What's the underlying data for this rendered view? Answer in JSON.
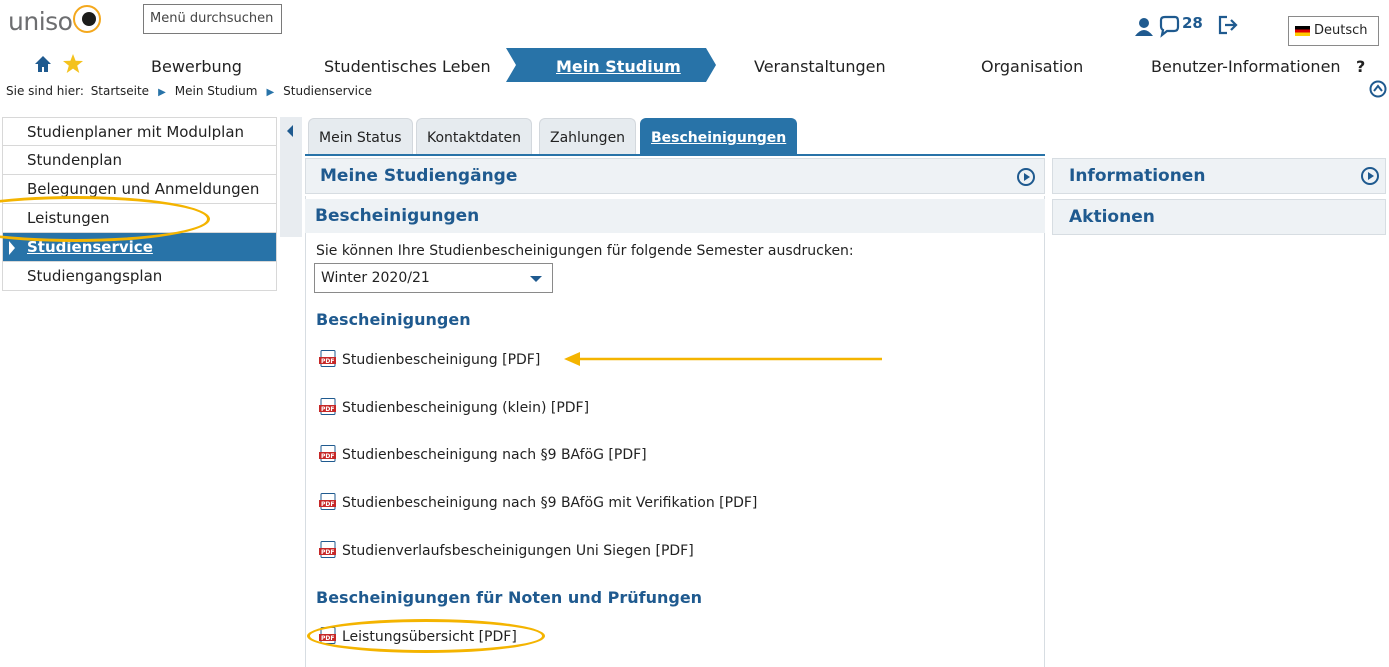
{
  "header": {
    "logo_text": "uniso",
    "menu_search_placeholder": "Menü durchsuchen",
    "message_count": "28",
    "language_label": "Deutsch"
  },
  "nav": {
    "items": [
      "Bewerbung",
      "Studentisches Leben",
      "Mein Studium",
      "Veranstaltungen",
      "Organisation",
      "Benutzer-Informationen"
    ],
    "help": "?"
  },
  "breadcrumb": {
    "prefix": "Sie sind hier:",
    "items": [
      "Startseite",
      "Mein Studium",
      "Studienservice"
    ]
  },
  "sidebar": {
    "items": [
      "Studienplaner mit Modulplan",
      "Stundenplan",
      "Belegungen und Anmeldungen",
      "Leistungen",
      "Studienservice",
      "Studiengangsplan"
    ]
  },
  "tabs": [
    "Mein Status",
    "Kontaktdaten",
    "Zahlungen",
    "Bescheinigungen"
  ],
  "main": {
    "panel1": "Meine Studiengänge",
    "panel2": "Bescheinigungen",
    "intro": "Sie können Ihre Studienbescheinigungen für folgende Semester ausdrucken:",
    "semester": "Winter 2020/21",
    "section1": "Bescheinigungen",
    "links1": [
      "Studienbescheinigung [PDF]",
      "Studienbescheinigung (klein) [PDF]",
      "Studienbescheinigung nach §9 BAföG [PDF]",
      "Studienbescheinigung nach §9 BAföG mit Verifikation [PDF]",
      "Studienverlaufsbescheinigungen Uni Siegen [PDF]"
    ],
    "section2": "Bescheinigungen für Noten und Prüfungen",
    "links2": [
      "Leistungsübersicht [PDF]"
    ]
  },
  "right": {
    "panel1": "Informationen",
    "panel2": "Aktionen"
  },
  "colors": {
    "primary": "#2873a8",
    "heading": "#1f5a8f",
    "highlight": "#f4b400"
  }
}
